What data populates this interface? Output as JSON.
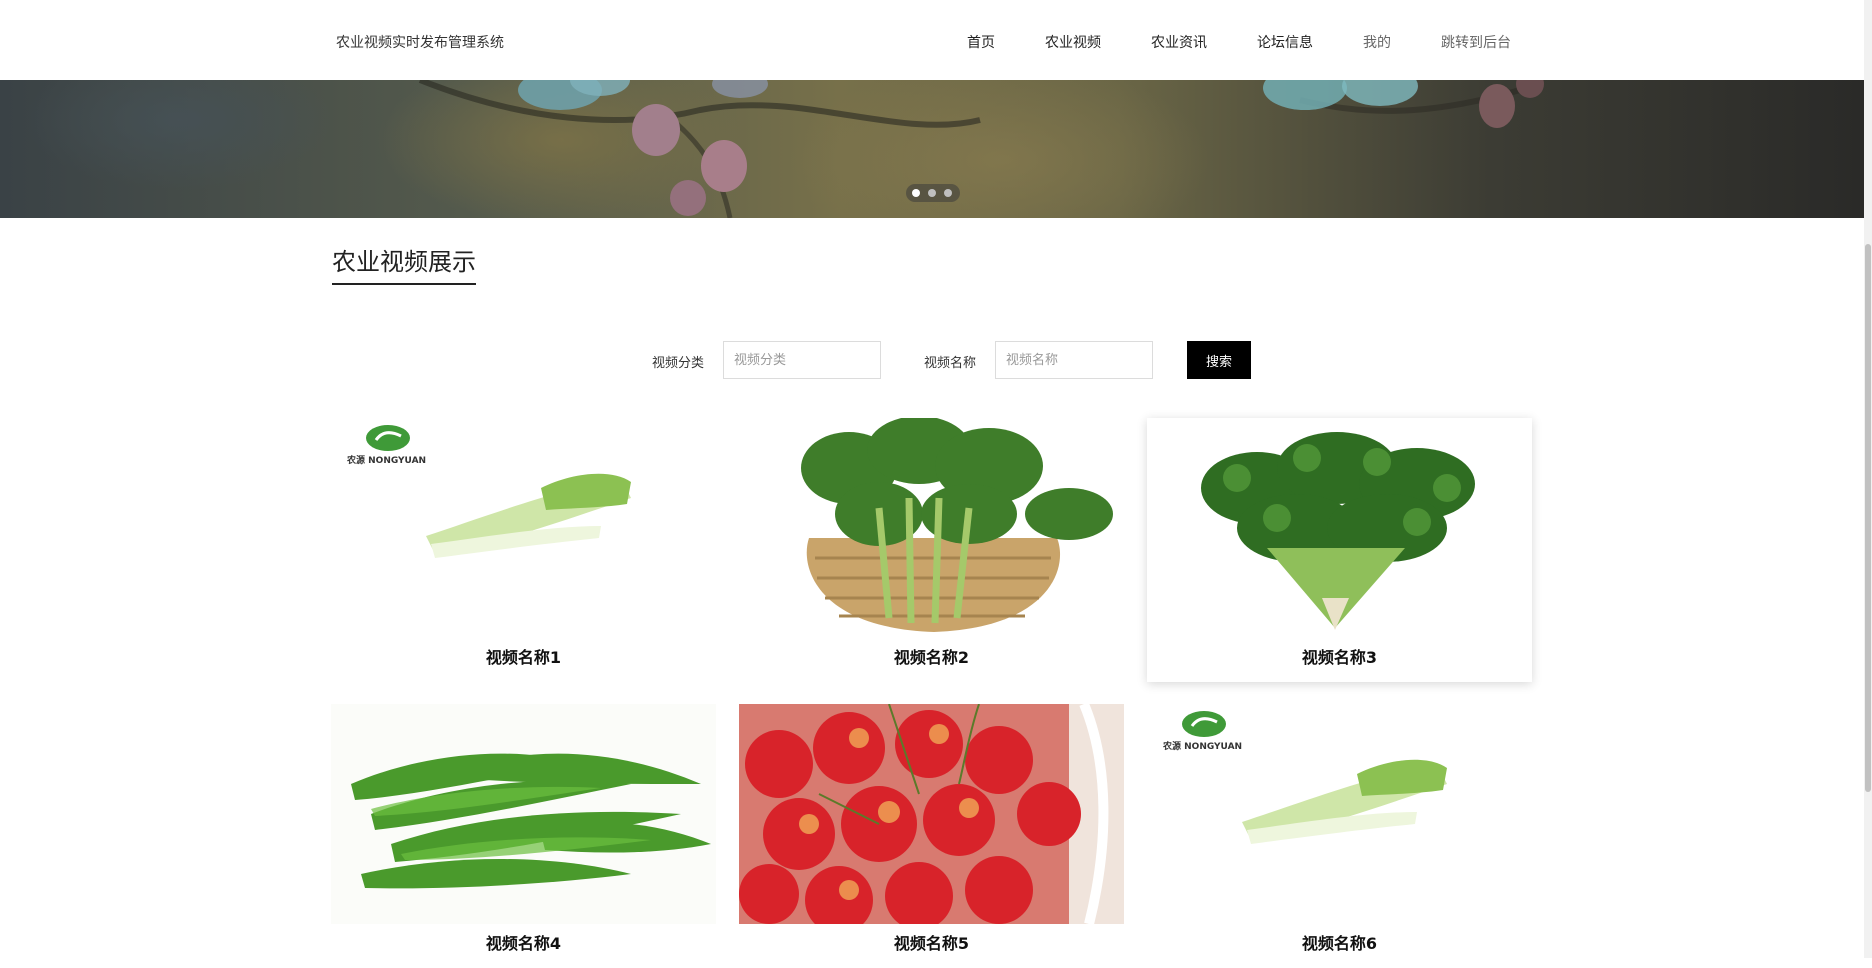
{
  "header": {
    "site_title": "农业视频实时发布管理系统",
    "nav": [
      "首页",
      "农业视频",
      "农业资讯",
      "论坛信息",
      "我的",
      "跳转到后台"
    ]
  },
  "banner": {
    "slide_count": 3,
    "active_slide": 1
  },
  "section": {
    "title": "农业视频展示"
  },
  "search": {
    "category_label": "视频分类",
    "category_placeholder": "视频分类",
    "name_label": "视频名称",
    "name_placeholder": "视频名称",
    "button": "搜索"
  },
  "videos": [
    {
      "name": "视频名称1",
      "image": "celery-cabbage",
      "logo": "农源 NONGYUAN"
    },
    {
      "name": "视频名称2",
      "image": "choy-sum-basket"
    },
    {
      "name": "视频名称3",
      "image": "cilantro"
    },
    {
      "name": "视频名称4",
      "image": "snow-peas"
    },
    {
      "name": "视频名称5",
      "image": "cherries"
    },
    {
      "name": "视频名称6",
      "image": "celery-cabbage",
      "logo": "农源 NONGYUAN"
    }
  ]
}
